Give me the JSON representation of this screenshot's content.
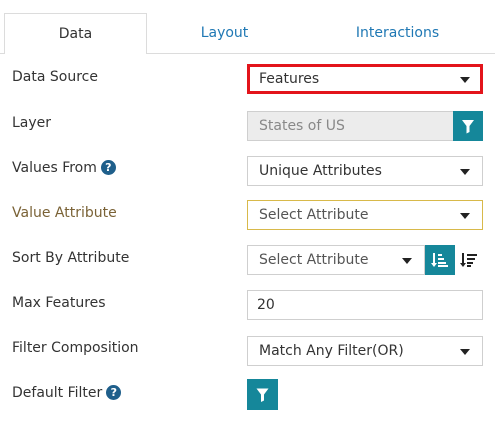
{
  "tabs": [
    {
      "label": "Data",
      "active": true
    },
    {
      "label": "Layout",
      "active": false
    },
    {
      "label": "Interactions",
      "active": false
    }
  ],
  "form": {
    "data_source": {
      "label": "Data Source",
      "value": "Features"
    },
    "layer": {
      "label": "Layer",
      "value": "States of US"
    },
    "values_from": {
      "label": "Values From",
      "value": "Unique Attributes",
      "help_icon": "?"
    },
    "value_attribute": {
      "label": "Value Attribute",
      "placeholder": "Select Attribute"
    },
    "sort_by_attribute": {
      "label": "Sort By Attribute",
      "placeholder": "Select Attribute"
    },
    "max_features": {
      "label": "Max Features",
      "value": "20"
    },
    "filter_composition": {
      "label": "Filter Composition",
      "value": "Match Any Filter(OR)"
    },
    "default_filter": {
      "label": "Default Filter",
      "help_icon": "?"
    }
  },
  "colors": {
    "accent_teal": "#15879a",
    "link_blue": "#1f78b4",
    "highlight_red": "#e3141b",
    "warning_border": "#d8b94a"
  },
  "icons": {
    "filter": "funnel-icon",
    "sort_asc": "sort-ascending-icon",
    "sort_desc": "sort-descending-icon",
    "help": "help-circle-icon",
    "caret": "caret-down-icon"
  }
}
